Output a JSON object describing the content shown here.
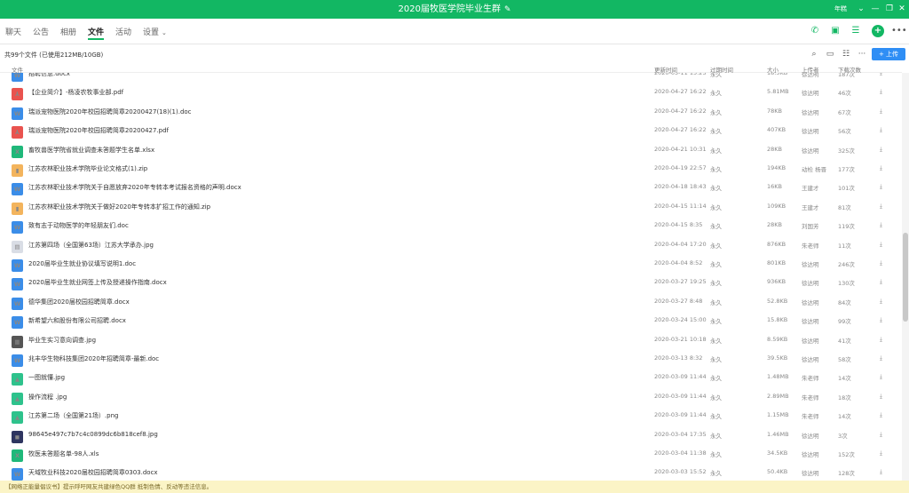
{
  "window": {
    "title": "2020届牧医学院毕业生群",
    "edit_icon": "pencil-icon",
    "user_name": "年糕"
  },
  "tabs": [
    {
      "label": "聊天"
    },
    {
      "label": "公告"
    },
    {
      "label": "相册"
    },
    {
      "label": "文件"
    },
    {
      "label": "活动"
    },
    {
      "label": "设置"
    }
  ],
  "active_tab": "文件",
  "file_info": {
    "count_text": "共99个文件 (已使用212MB/10GB)",
    "upload_label": "+ 上传"
  },
  "columns": {
    "name": "文件",
    "updated": "更新时间",
    "expiry": "过期时间",
    "size": "大小",
    "uploader": "上传者",
    "downloads": "下载次数"
  },
  "files": [
    {
      "icon": "doc",
      "name": "招聘信息.docx",
      "updated": "2020-05-11 15:25",
      "expiry": "永久",
      "size": "18.5KB",
      "uploader": "徐达明",
      "downloads": "187次"
    },
    {
      "icon": "pdf",
      "name": "【企业简介】-杨凌农牧事业部.pdf",
      "updated": "2020-04-27 16:22",
      "expiry": "永久",
      "size": "5.81MB",
      "uploader": "徐达明",
      "downloads": "46次"
    },
    {
      "icon": "doc",
      "name": "瑞派宠物医院2020年校园招聘简章20200427(18)(1).doc",
      "updated": "2020-04-27 16:22",
      "expiry": "永久",
      "size": "78KB",
      "uploader": "徐达明",
      "downloads": "67次"
    },
    {
      "icon": "pdf",
      "name": "瑞派宠物医院2020年校园招聘简章20200427.pdf",
      "updated": "2020-04-27 16:22",
      "expiry": "永久",
      "size": "407KB",
      "uploader": "徐达明",
      "downloads": "56次"
    },
    {
      "icon": "xls",
      "name": "畜牧兽医学院省就业调查未答题学生名单.xlsx",
      "updated": "2020-04-21 10:31",
      "expiry": "永久",
      "size": "28KB",
      "uploader": "徐达明",
      "downloads": "325次"
    },
    {
      "icon": "zip",
      "name": "江苏农林职业技术学院毕业论文格式(1).zip",
      "updated": "2020-04-19 22:57",
      "expiry": "永久",
      "size": "194KB",
      "uploader": "动检 杨晋",
      "downloads": "177次"
    },
    {
      "icon": "doc",
      "name": "江苏农林职业技术学院关于自愿放弃2020年专转本考试报名资格的声明.docx",
      "updated": "2020-04-18 18:43",
      "expiry": "永久",
      "size": "16KB",
      "uploader": "王建才",
      "downloads": "101次"
    },
    {
      "icon": "zip",
      "name": "江苏农林职业技术学院关于做好2020年专转本扩招工作的通知.zip",
      "updated": "2020-04-15 11:14",
      "expiry": "永久",
      "size": "109KB",
      "uploader": "王建才",
      "downloads": "81次"
    },
    {
      "icon": "doc",
      "name": "致有志于动物医学的年轻朋友们.doc",
      "updated": "2020-04-15 8:35",
      "expiry": "永久",
      "size": "28KB",
      "uploader": "刘国芳",
      "downloads": "119次"
    },
    {
      "icon": "thumb1",
      "name": "江苏第四场（全国第63场）江苏大学承办.jpg",
      "updated": "2020-04-04 17:20",
      "expiry": "永久",
      "size": "876KB",
      "uploader": "朱老师",
      "downloads": "11次"
    },
    {
      "icon": "doc",
      "name": "2020届毕业生就业协议填写说明1.doc",
      "updated": "2020-04-04 8:52",
      "expiry": "永久",
      "size": "801KB",
      "uploader": "徐达明",
      "downloads": "246次"
    },
    {
      "icon": "doc",
      "name": "2020届毕业生就业网签上传及授递操作指南.docx",
      "updated": "2020-03-27 19:25",
      "expiry": "永久",
      "size": "936KB",
      "uploader": "徐达明",
      "downloads": "130次"
    },
    {
      "icon": "doc",
      "name": "德华集团2020届校园招聘简章.docx",
      "updated": "2020-03-27 8:48",
      "expiry": "永久",
      "size": "52.8KB",
      "uploader": "徐达明",
      "downloads": "84次"
    },
    {
      "icon": "doc",
      "name": "新希望六和股份有限公司招聘.docx",
      "updated": "2020-03-24 15:00",
      "expiry": "永久",
      "size": "15.8KB",
      "uploader": "徐达明",
      "downloads": "99次"
    },
    {
      "icon": "thumb2",
      "name": "毕业生实习意向调查.jpg",
      "updated": "2020-03-21 10:18",
      "expiry": "永久",
      "size": "8.59KB",
      "uploader": "徐达明",
      "downloads": "41次"
    },
    {
      "icon": "doc",
      "name": "兆丰华生物科技集团2020年招聘简章-最新.doc",
      "updated": "2020-03-13 8:32",
      "expiry": "永久",
      "size": "39.5KB",
      "uploader": "徐达明",
      "downloads": "58次"
    },
    {
      "icon": "jpg",
      "name": "一图就懂.jpg",
      "updated": "2020-03-09 11:44",
      "expiry": "永久",
      "size": "1.48MB",
      "uploader": "朱老师",
      "downloads": "14次"
    },
    {
      "icon": "jpg",
      "name": "操作流程 .jpg",
      "updated": "2020-03-09 11:44",
      "expiry": "永久",
      "size": "2.89MB",
      "uploader": "朱老师",
      "downloads": "18次"
    },
    {
      "icon": "jpg",
      "name": "江苏第二场（全国第21场）.png",
      "updated": "2020-03-09 11:44",
      "expiry": "永久",
      "size": "1.15MB",
      "uploader": "朱老师",
      "downloads": "14次"
    },
    {
      "icon": "thumb3",
      "name": "98645e497c7b7c4c0899dc6b818cef8.jpg",
      "updated": "2020-03-04 17:35",
      "expiry": "永久",
      "size": "1.46MB",
      "uploader": "徐达明",
      "downloads": "3次"
    },
    {
      "icon": "xls",
      "name": "牧医未答题名单-98人.xls",
      "updated": "2020-03-04 11:38",
      "expiry": "永久",
      "size": "34.5KB",
      "uploader": "徐达明",
      "downloads": "152次"
    },
    {
      "icon": "doc",
      "name": "天域牧业科技2020届校园招聘简章0303.docx",
      "updated": "2020-03-03 15:52",
      "expiry": "永久",
      "size": "50.4KB",
      "uploader": "徐达明",
      "downloads": "128次"
    }
  ],
  "notice": "【网络正能量倡议书】提示呼吁网友共建绿色QQ群 抵制色情、反动等违法信息。"
}
